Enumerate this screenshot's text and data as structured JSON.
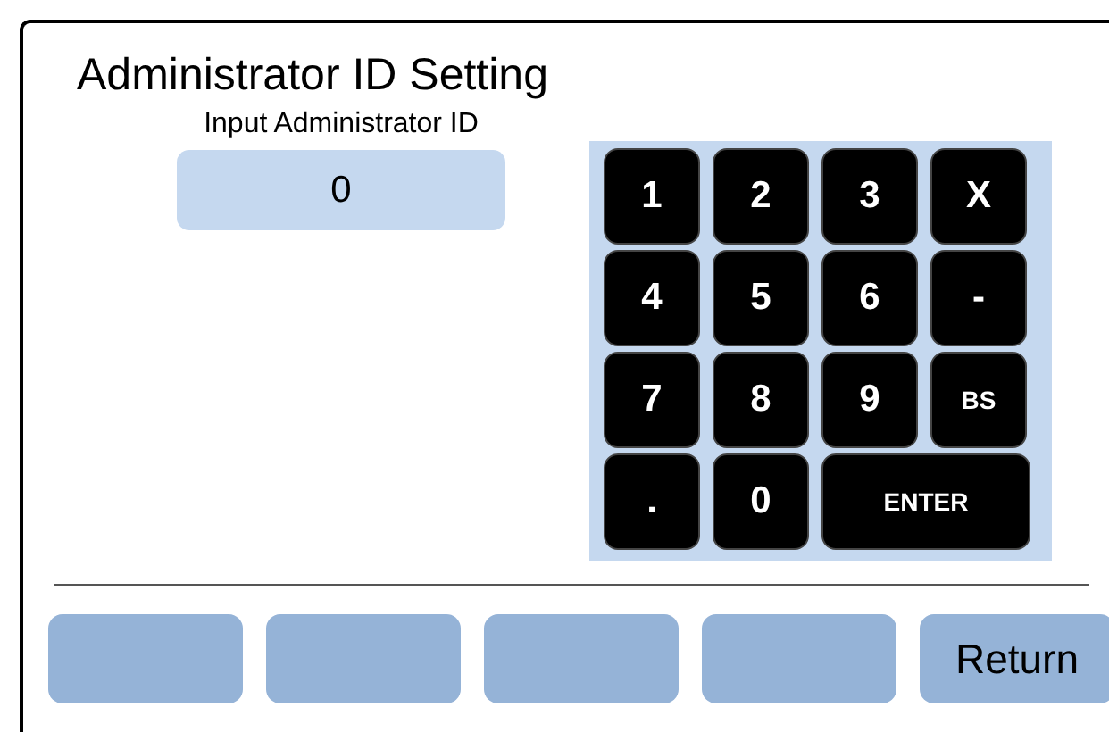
{
  "screen": {
    "title": "Administrator ID Setting"
  },
  "input": {
    "label": "Input Administrator ID",
    "value": "0"
  },
  "keypad": [
    {
      "label": "1",
      "kind": "big"
    },
    {
      "label": "2",
      "kind": "big"
    },
    {
      "label": "3",
      "kind": "big"
    },
    {
      "label": "X",
      "kind": "big"
    },
    {
      "label": "4",
      "kind": "big"
    },
    {
      "label": "5",
      "kind": "big"
    },
    {
      "label": "6",
      "kind": "big"
    },
    {
      "label": "-",
      "kind": "big"
    },
    {
      "label": "7",
      "kind": "big"
    },
    {
      "label": "8",
      "kind": "big"
    },
    {
      "label": "9",
      "kind": "big"
    },
    {
      "label": "BS",
      "kind": "small"
    },
    {
      "label": ".",
      "kind": "big"
    },
    {
      "label": "0",
      "kind": "big"
    },
    {
      "label": "ENTER",
      "kind": "wide"
    }
  ],
  "buttons": [
    {
      "kind": "blank"
    },
    {
      "kind": "blank"
    },
    {
      "kind": "blank"
    },
    {
      "kind": "blank"
    },
    {
      "kind": "labeled",
      "label": "Return"
    }
  ]
}
